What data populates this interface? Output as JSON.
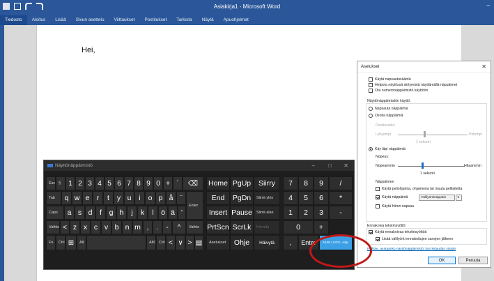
{
  "word": {
    "title": "Asiakirja1 - Microsoft Word",
    "min_glyph": "–",
    "ribbon_tabs": [
      "Tiedosto",
      "Aloitus",
      "Lisää",
      "Sivun asettelu",
      "Viittaukset",
      "Postitukset",
      "Tarkista",
      "Näytä",
      "Apuohjelmat"
    ],
    "document_text": "Hei,"
  },
  "osk": {
    "title": "Näyttönäppäimistö",
    "min": "–",
    "restore": "□",
    "close": "✕",
    "keys": {
      "esc": "Esc",
      "tilde": "§",
      "n1": "1",
      "n2": "2",
      "n3": "3",
      "n4": "4",
      "n5": "5",
      "n6": "6",
      "n7": "7",
      "n8": "8",
      "n9": "9",
      "n0": "0",
      "plus": "+",
      "acute": "´",
      "bksp": "⌫",
      "home": "Home",
      "pgup": "PgUp",
      "siirry": "Siirry",
      "np7": "7",
      "np8": "8",
      "np9": "9",
      "npdiv": "/",
      "tab": "Tab",
      "q": "q",
      "w": "w",
      "e": "e",
      "r": "r",
      "t": "t",
      "y": "y",
      "u": "u",
      "i": "i",
      "o": "o",
      "p": "p",
      "aring": "å",
      "diaer": "¨",
      "enter": "Enter",
      "end": "End",
      "pgdn": "PgDn",
      "siirra_ylos": "Siirrä ylös",
      "np4": "4",
      "np5": "5",
      "np6": "6",
      "npmul": "*",
      "caps": "Caps",
      "a": "a",
      "s": "s",
      "d": "d",
      "f": "f",
      "g": "g",
      "h": "h",
      "j": "j",
      "k": "k",
      "l": "l",
      "ouml": "ö",
      "auml": "ä",
      "apos": "'",
      "insert": "Insert",
      "pause": "Pause",
      "siirra_alas": "Siirrä alas",
      "np1": "1",
      "np2": "2",
      "np3": "3",
      "npminus": "-",
      "shift_l": "Vaihto",
      "lt": "<",
      "z": "z",
      "x": "x",
      "c": "c",
      "v": "v",
      "b": "b",
      "n": "n",
      "m": "m",
      "comma": ",",
      "dot": ".",
      "dash": "-",
      "up": "^",
      "shift_r": "Vaihto",
      "prtscn": "PrtScn",
      "scrlk": "ScrLk",
      "kiinnita": "Kiinnitä",
      "np0": "0",
      "npplus": "+",
      "fn": "Fn",
      "ctrl": "Ctrl",
      "win": "⊞",
      "alt": "Alt",
      "altgr": "AltGr",
      "ctrl_r": "Ctrl",
      "left": "<",
      "down": "∨",
      "right": ">",
      "menu": "▤",
      "asetukset": "Asetukset",
      "ohje": "Ohje",
      "haivyta": "Häivytä",
      "npdot": ",",
      "npenter": "Enter",
      "numlock": "NUM LOCK -näp."
    }
  },
  "dlg": {
    "title": "Asetukset",
    "close": "✕",
    "cb_click_sound": "Käytä napsautusääntä",
    "cb_nav_keys": "Helpota näytössä siirtymistä näyttämällä näppäimet",
    "cb_numpad": "Ota numeronäppäimistö käyttöön",
    "usage_label": "Näyttönäppäimistön käyttö:",
    "rb_click": "Napsauta näppäimiä",
    "rb_hover": "Osoita näppäimiä",
    "hover_duration": "Osoitusaika:",
    "hover_short": "Lyhyempi",
    "hover_long": "Pidempi",
    "hover_value": "1 sekunti",
    "rb_scan": "Käy läpi näppäimiä",
    "speed_label": "Nopeus:",
    "speed_fast": "Nopeammin",
    "speed_slow": "Hitaammin",
    "speed_value": "1 sekunti",
    "keys_label": "Näppäimen",
    "cb_joystick": "Käytä peliohjainta, ohjaimena tai muuta pelilaitetta",
    "cb_key_select": "Käytä näppäintä",
    "key_select_value": "Välilyöntinäppäin",
    "cb_sleep": "Käytä hiiren napsaa",
    "predict_label": "Ennakoiva tekstinsyöttö:",
    "cb_predict": "Käytä ennakoivaa tekstinsyöttöä",
    "cb_space": "Lisää välilyönti ennakoitujen sanojen jälkeen",
    "link": "Hallitse, avataanko näyttönäppäimistö, kun kirjaudun sisään",
    "ok": "OK",
    "cancel": "Peruuta"
  }
}
